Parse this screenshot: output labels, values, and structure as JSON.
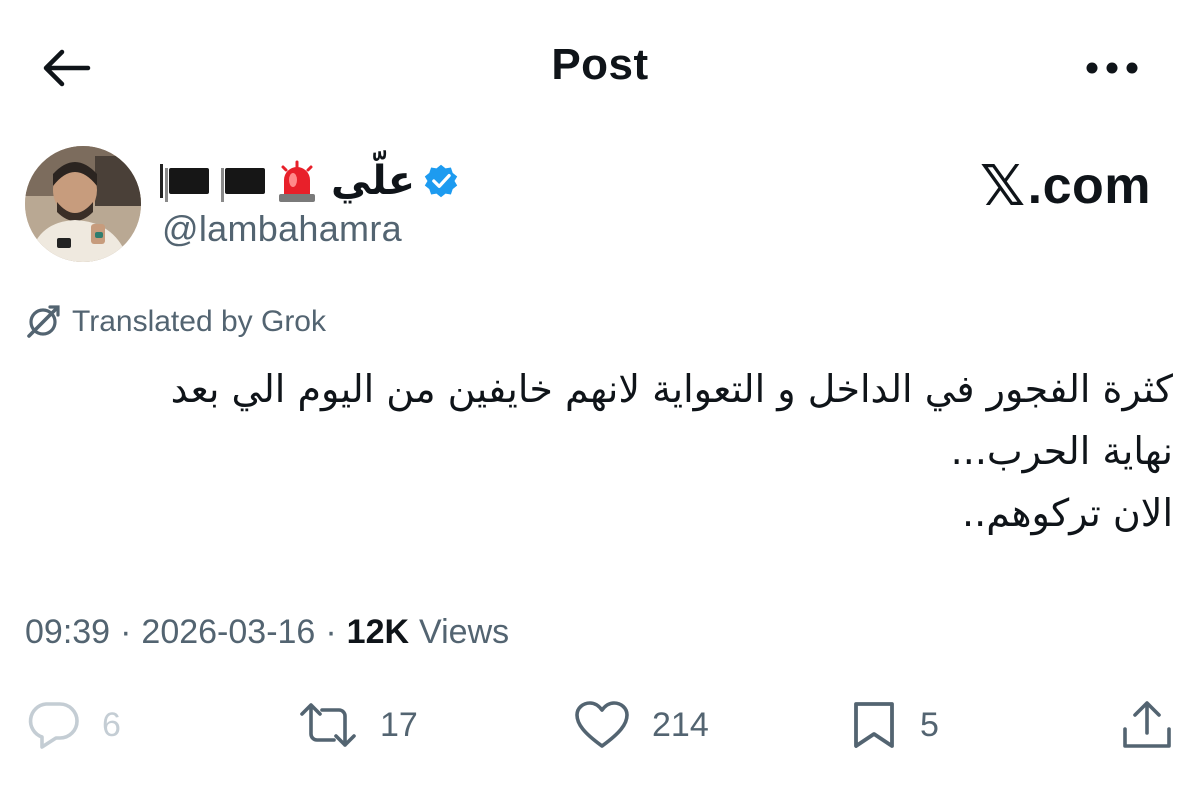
{
  "header": {
    "title": "Post"
  },
  "author": {
    "display_name": "علّي",
    "handle": "@lambahamra"
  },
  "watermark": {
    "text": ".com"
  },
  "translated": {
    "label": "Translated by Grok"
  },
  "tweet": {
    "lines": [
      "كثرة الفجور في الداخل و التعواية لانهم خايفين من اليوم الي بعد",
      "نهاية الحرب...",
      "الان تركوهم.."
    ]
  },
  "meta": {
    "time": "09:39",
    "separator": "·",
    "date": "2026-03-16",
    "views_count": "12K",
    "views_label": "Views"
  },
  "actions": {
    "reply_count": "6",
    "repost_count": "17",
    "like_count": "214",
    "bookmark_count": "5"
  },
  "icons": {
    "back": "arrow-left-icon",
    "more": "more-horizontal-icon",
    "verified": "verified-badge-icon",
    "siren": "siren-emoji-icon",
    "flag": "black-flag-emoji-icon",
    "grok": "grok-logo-icon",
    "reply": "reply-icon",
    "repost": "repost-icon",
    "like": "heart-icon",
    "bookmark": "bookmark-icon",
    "share": "share-icon"
  },
  "colors": {
    "text": "#0f1419",
    "secondary": "#536471",
    "verified": "#1d9bf0",
    "muted": "#c4cdd4"
  }
}
